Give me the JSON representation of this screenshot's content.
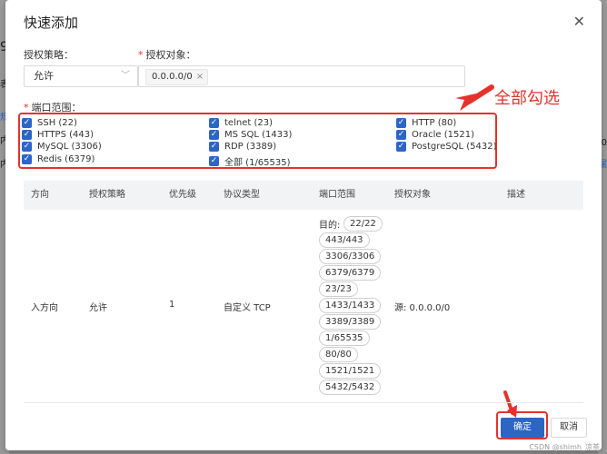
{
  "dialog": {
    "title": "快速添加",
    "close_icon": "close-icon"
  },
  "form": {
    "policy_label": "授权策略：",
    "policy_value": "允许",
    "target_label": "授权对象：",
    "target_tag": "0.0.0.0/0",
    "tag_remove": "×",
    "ports_label": "端口范围："
  },
  "ports": [
    {
      "label": "SSH (22)",
      "checked": true
    },
    {
      "label": "HTTPS (443)",
      "checked": true
    },
    {
      "label": "MySQL (3306)",
      "checked": true
    },
    {
      "label": "Redis (6379)",
      "checked": true
    },
    {
      "label": "telnet (23)",
      "checked": true
    },
    {
      "label": "MS SQL (1433)",
      "checked": true
    },
    {
      "label": "RDP (3389)",
      "checked": true
    },
    {
      "label": "全部 (1/65535)",
      "checked": true
    },
    {
      "label": "HTTP (80)",
      "checked": true
    },
    {
      "label": "Oracle (1521)",
      "checked": true
    },
    {
      "label": "PostgreSQL (5432)",
      "checked": true
    }
  ],
  "annotation": {
    "text": "全部勾选",
    "color": "#e5322d"
  },
  "table": {
    "headers": [
      "方向",
      "授权策略",
      "优先级",
      "协议类型",
      "端口范围",
      "授权对象",
      "描述"
    ],
    "row": {
      "direction": "入方向",
      "policy": "允许",
      "priority": "1",
      "protocol": "自定义 TCP",
      "port_prefix": "目的:",
      "port_chips": [
        "22/22",
        "443/443",
        "3306/3306",
        "6379/6379",
        "23/23",
        "1433/1433",
        "3389/3389",
        "1/65535",
        "80/80",
        "1521/1521",
        "5432/5432"
      ],
      "target": "源: 0.0.0.0/0",
      "description": ""
    }
  },
  "footer": {
    "confirm": "确定",
    "cancel": "取消"
  },
  "background": {
    "left_fragments": [
      "9",
      "表",
      "规",
      "内",
      "内"
    ],
    "right_fragments": [
      "'20",
      "漏"
    ]
  },
  "watermark": "CSDN @shimh_凉茶",
  "colors": {
    "primary": "#2b66c6",
    "highlight": "#e5322d"
  }
}
